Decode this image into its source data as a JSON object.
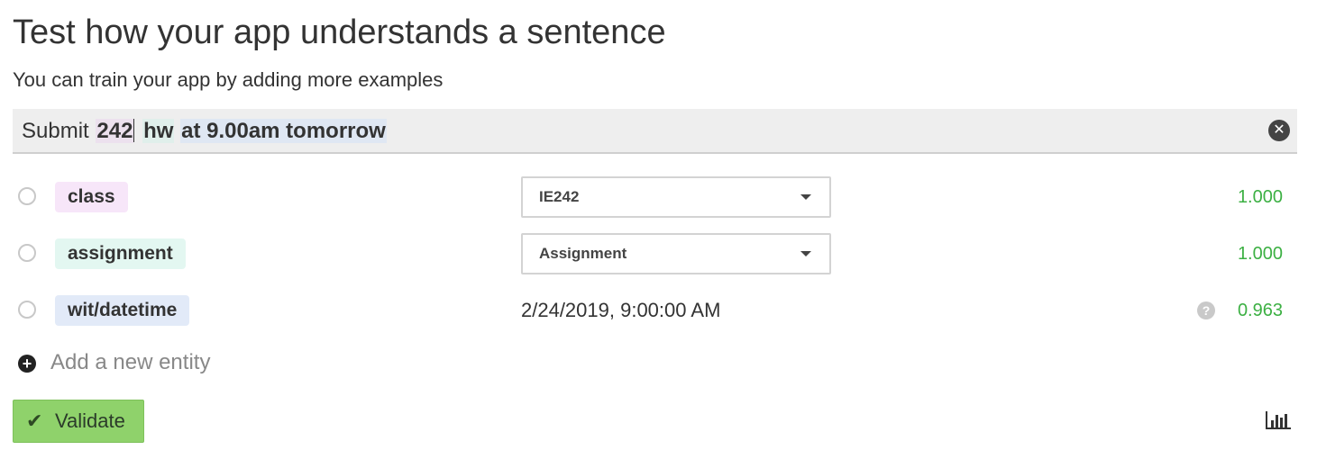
{
  "header": {
    "title": "Test how your app understands a sentence",
    "subtitle": "You can train your app by adding more examples"
  },
  "sentence": {
    "segments": [
      {
        "text": "Submit ",
        "entity": null
      },
      {
        "text": "242",
        "entity": "class"
      },
      {
        "text": "hw",
        "entity": "assignment"
      },
      {
        "text": "at 9.00am tomorrow",
        "entity": "wit/datetime"
      }
    ],
    "clear_icon": "close-circle-icon"
  },
  "entities": [
    {
      "name": "class",
      "value": "IE242",
      "value_type": "select",
      "confidence": "1.000",
      "color": "#f7e6f9"
    },
    {
      "name": "assignment",
      "value": "Assignment",
      "value_type": "select",
      "confidence": "1.000",
      "color": "#e3f7f1"
    },
    {
      "name": "wit/datetime",
      "value": "2/24/2019, 9:00:00 AM",
      "value_type": "text",
      "confidence": "0.963",
      "color": "#e2eaf8",
      "has_help": true
    }
  ],
  "add_entity": {
    "label": "Add a new entity",
    "icon": "plus-circle-icon"
  },
  "validate": {
    "label": "Validate",
    "icon": "check-icon",
    "color": "#8fd26b"
  },
  "stats_icon": "bar-chart-icon",
  "colors": {
    "confidence": "#3cb043"
  }
}
